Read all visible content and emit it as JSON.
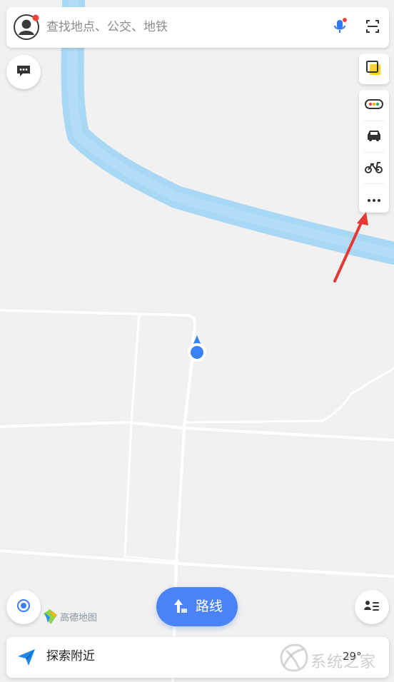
{
  "search": {
    "placeholder": "查找地点、公交、地铁",
    "value": ""
  },
  "route_button": {
    "label": "路线"
  },
  "bottom_bar": {
    "label": "探索附近",
    "temperature_partial": "29°"
  },
  "watermark_logo": {
    "text": "高德地图"
  },
  "watermark_site": {
    "text": "系统之家"
  },
  "icons": {
    "avatar": "user-avatar-icon",
    "mic": "microphone-icon",
    "scan": "scan-icon",
    "message": "message-icon",
    "layers": "layers-icon",
    "traffic": "traffic-light-icon",
    "car": "car-icon",
    "bike": "bicycle-icon",
    "more": "more-icon",
    "locate": "locate-icon",
    "trip": "trip-card-icon",
    "explore": "paper-plane-icon"
  },
  "colors": {
    "map_background": "#f1f1f2",
    "river": "#a7d8f5",
    "road": "#ffffff",
    "primary_blue": "#4a83f8",
    "notification_red": "#f44336",
    "annotation_red": "#e53935"
  }
}
